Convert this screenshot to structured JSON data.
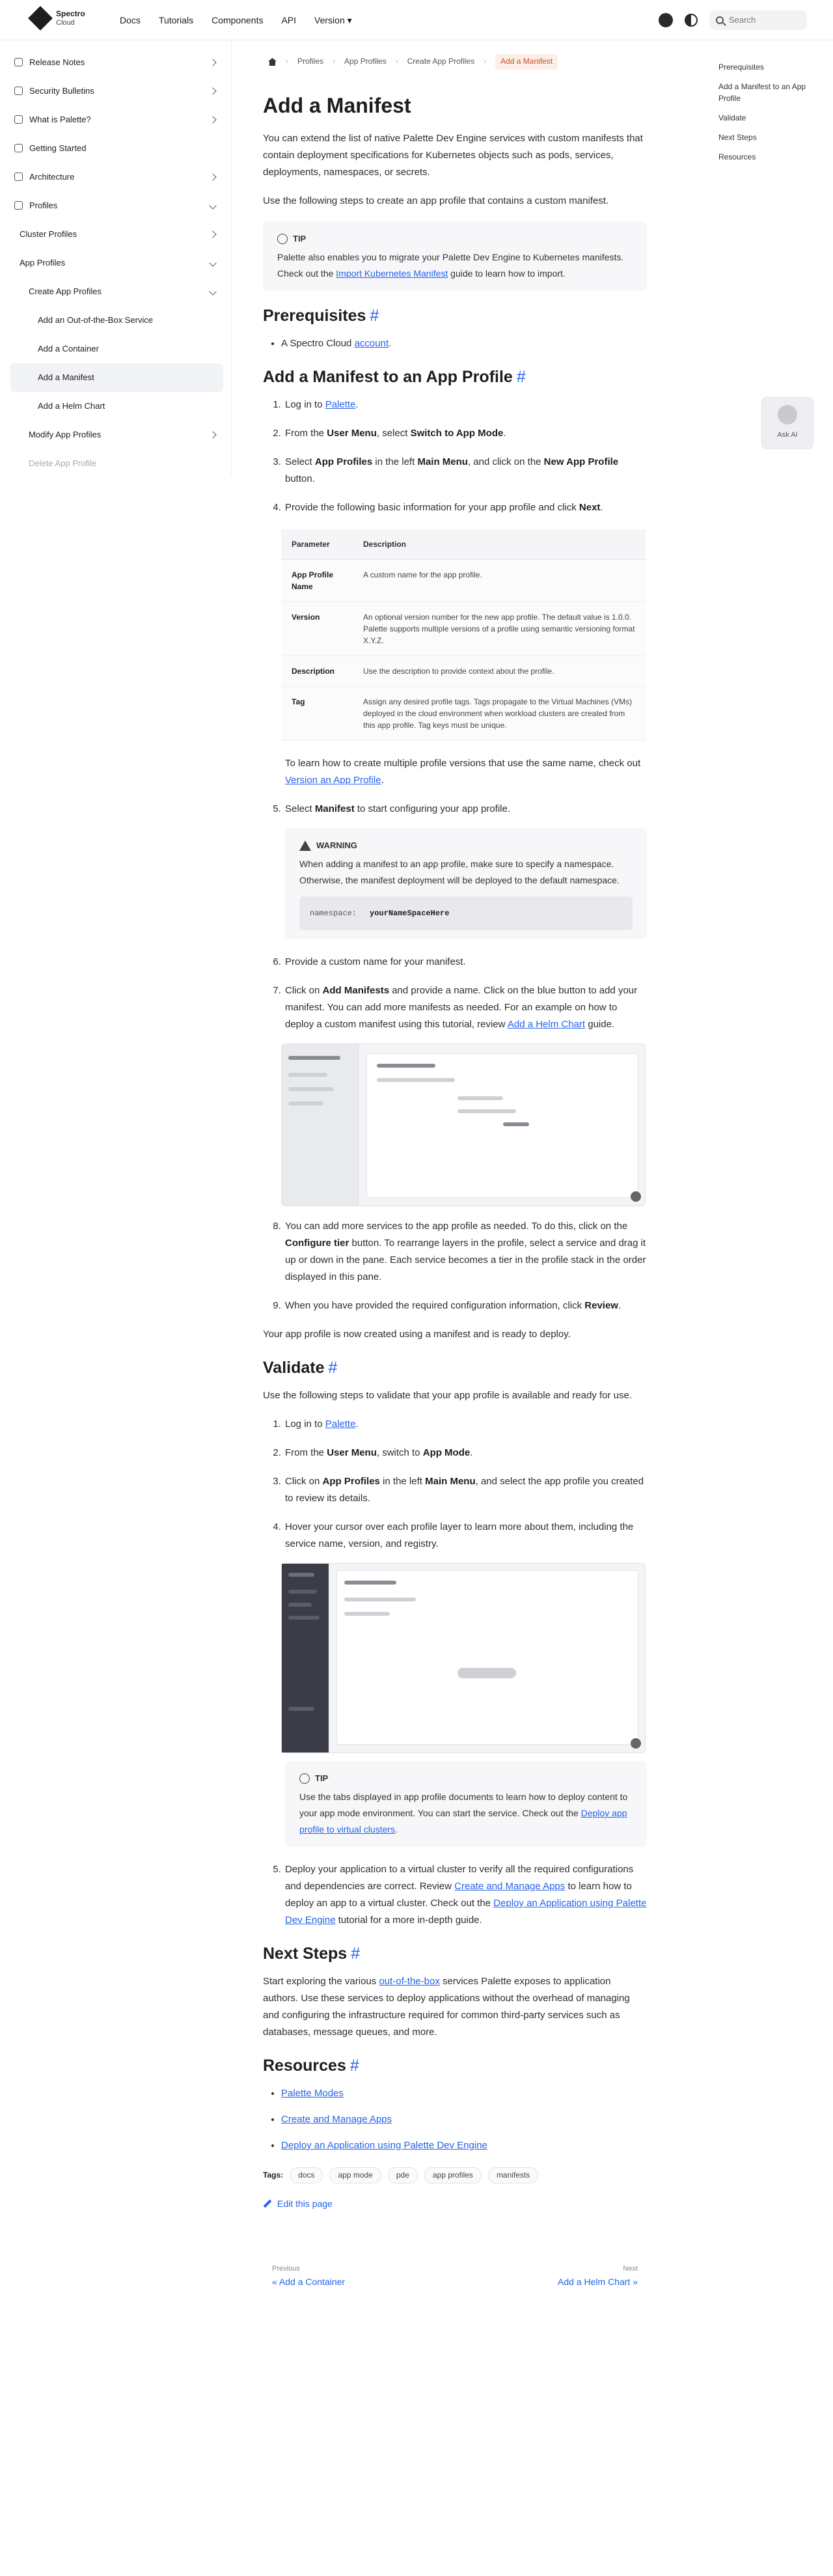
{
  "nav": {
    "logo_line1": "Spectro",
    "logo_line2": "Cloud",
    "links": [
      "Docs",
      "Tutorials",
      "Components",
      "API",
      "Version"
    ],
    "search_placeholder": "Search"
  },
  "sidebar": {
    "items": [
      {
        "label": "Release Notes",
        "level": 0,
        "icon": "sb-icon",
        "chevron": "right"
      },
      {
        "label": "Security Bulletins",
        "level": 0,
        "icon": "sb-icon",
        "chevron": "right"
      },
      {
        "label": "What is Palette?",
        "level": 0,
        "icon": "sb-icon",
        "chevron": "right"
      },
      {
        "label": "Getting Started",
        "level": 0,
        "icon": "sb-icon",
        "chevron": ""
      },
      {
        "label": "Architecture",
        "level": 0,
        "icon": "sb-icon",
        "chevron": "right"
      },
      {
        "label": "Profiles",
        "level": 0,
        "icon": "sb-icon",
        "chevron": "down"
      },
      {
        "label": "Cluster Profiles",
        "level": 1,
        "icon": "",
        "chevron": "right"
      },
      {
        "label": "App Profiles",
        "level": 1,
        "icon": "",
        "chevron": "down"
      },
      {
        "label": "Create App Profiles",
        "level": 2,
        "icon": "",
        "chevron": "down"
      },
      {
        "label": "Add an Out-of-the-Box Service",
        "level": 3,
        "icon": "",
        "chevron": ""
      },
      {
        "label": "Add a Container",
        "level": 3,
        "icon": "",
        "chevron": ""
      },
      {
        "label": "Add a Manifest",
        "level": 3,
        "icon": "",
        "chevron": "",
        "active": true
      },
      {
        "label": "Add a Helm Chart",
        "level": 3,
        "icon": "",
        "chevron": ""
      },
      {
        "label": "Modify App Profiles",
        "level": 2,
        "icon": "",
        "chevron": "right"
      },
      {
        "label": "Delete App Profile",
        "level": 2,
        "icon": "",
        "chevron": "",
        "faded": true
      }
    ]
  },
  "breadcrumb": [
    "Profiles",
    "App Profiles",
    "Create App Profiles",
    "Add a Manifest"
  ],
  "page": {
    "title": "Add a Manifest",
    "intro": "You can extend the list of native Palette Dev Engine services with custom manifests that contain deployment specifications for Kubernetes objects such as pods, services, deployments, namespaces, or secrets.",
    "intro2": "Use the following steps to create an app profile that contains a custom manifest.",
    "tip1_head": "TIP",
    "tip1_text_a": "Palette also enables you to migrate your Palette Dev Engine to Kubernetes manifests. Check out the ",
    "tip1_link": "Import Kubernetes Manifest",
    "tip1_text_b": " guide to learn how to import."
  },
  "prereq": {
    "title": "Prerequisites",
    "item_prefix": "A Spectro Cloud ",
    "item_link": "account",
    "item_suffix": "."
  },
  "add_section": {
    "title": "Add a Manifest to an App Profile",
    "s1_a": "Log in to ",
    "s1_link": "Palette",
    "s1_b": ".",
    "s2_a": "From the ",
    "s2_b1": "User Menu",
    "s2_c": ", select ",
    "s2_b2": "Switch to App Mode",
    "s2_d": ".",
    "s3_a": "Select ",
    "s3_b1": "App Profiles",
    "s3_c": " in the left ",
    "s3_b2": "Main Menu",
    "s3_d": ", and click on the ",
    "s3_b3": "New App Profile",
    "s3_e": " button.",
    "s4_a": "Provide the following basic information for your app profile and click ",
    "s4_b": "Next",
    "s4_c": ".",
    "table": {
      "headers": [
        "Parameter",
        "Description"
      ],
      "rows": [
        {
          "name": "App Profile Name",
          "desc": "A custom name for the app profile."
        },
        {
          "name": "Version",
          "desc": "An optional version number for the new app profile. The default value is 1.0.0. Palette supports multiple versions of a profile using semantic versioning format X.Y.Z."
        },
        {
          "name": "Description",
          "desc": "Use the description to provide context about the profile."
        },
        {
          "name": "Tag",
          "desc": "Assign any desired profile tags. Tags propagate to the Virtual Machines (VMs) deployed in the cloud environment when workload clusters are created from this app profile. Tag keys must be unique."
        }
      ]
    },
    "s4_note_a": "To learn how to create multiple profile versions that use the same name, check out ",
    "s4_note_link": "Version an App Profile",
    "s4_note_b": ".",
    "s5_a": "Select ",
    "s5_b": "Manifest",
    "s5_c": " to start configuring your app profile.",
    "warn_head": "WARNING",
    "warn_text": "When adding a manifest to an app profile, make sure to specify a namespace. Otherwise, the manifest deployment will be deployed to the default namespace.",
    "code_key": "namespace:",
    "code_val": "yourNameSpaceHere",
    "s6": "Provide a custom name for your manifest.",
    "s7_a": "Click on ",
    "s7_b": "Add Manifests",
    "s7_c": " and provide a name. Click on the blue button to add your manifest. You can add more manifests as needed. For an example on how to deploy a custom manifest using this tutorial, review ",
    "s7_link": "Add a Helm Chart",
    "s7_d": " guide.",
    "s8_a": "You can add more services to the app profile as needed. To do this, click on the ",
    "s8_b": "Configure tier",
    "s8_c": " button. To rearrange layers in the profile, select a service and drag it up or down in the pane. Each service becomes a tier in the profile stack in the order displayed in this pane.",
    "s9_a": "When you have provided the required configuration information, click ",
    "s9_b": "Review",
    "s9_c": ".",
    "done": "Your app profile is now created using a manifest and is ready to deploy."
  },
  "validate": {
    "title": "Validate",
    "intro": "Use the following steps to validate that your app profile is available and ready for use.",
    "v1_a": "Log in to ",
    "v1_link": "Palette",
    "v1_b": ".",
    "v2_a": "From the ",
    "v2_b1": "User Menu",
    "v2_c": ", switch to ",
    "v2_b2": "App Mode",
    "v2_d": ".",
    "v3_a": "Click on ",
    "v3_b1": "App Profiles",
    "v3_c": " in the left ",
    "v3_b2": "Main Menu",
    "v3_d": ", and select the app profile you created to review its details.",
    "v4": "Hover your cursor over each profile layer to learn more about them, including the service name, version, and registry.",
    "tip2_head": "TIP",
    "tip2_a": "Use the tabs displayed in app profile documents to learn how to deploy content to your app mode environment. You can start the service. Check out the ",
    "tip2_link": "Deploy app profile to virtual clusters",
    "tip2_b": ".",
    "v5_a": "Deploy your application to a virtual cluster to verify all the required configurations and dependencies are correct. Review ",
    "v5_link1": "Create and Manage Apps",
    "v5_b": " to learn how to deploy an app to a virtual cluster. Check out the ",
    "v5_link2": "Deploy an Application using Palette Dev Engine",
    "v5_c": " tutorial for a more in-depth guide."
  },
  "next": {
    "title": "Next Steps",
    "text_a": "Start exploring the various ",
    "text_link": "out-of-the-box",
    "text_b": " services Palette exposes to application authors. Use these services to deploy applications without the overhead of managing and configuring the infrastructure required for common third-party services such as databases, message queues, and more."
  },
  "resources": {
    "title": "Resources",
    "items": [
      "Palette Modes",
      "Create and Manage Apps",
      "Deploy an Application using Palette Dev Engine"
    ]
  },
  "tags": {
    "label": "Tags:",
    "items": [
      "docs",
      "app mode",
      "pde",
      "app profiles",
      "manifests"
    ]
  },
  "edit": "Edit this page",
  "pager": {
    "prev_sub": "Previous",
    "prev_title": "« Add a Container",
    "next_sub": "Next",
    "next_title": "Add a Helm Chart »"
  },
  "toc": [
    "Prerequisites",
    "Add a Manifest to an App Profile",
    "Validate",
    "Next Steps",
    "Resources"
  ],
  "help": "Ask AI"
}
